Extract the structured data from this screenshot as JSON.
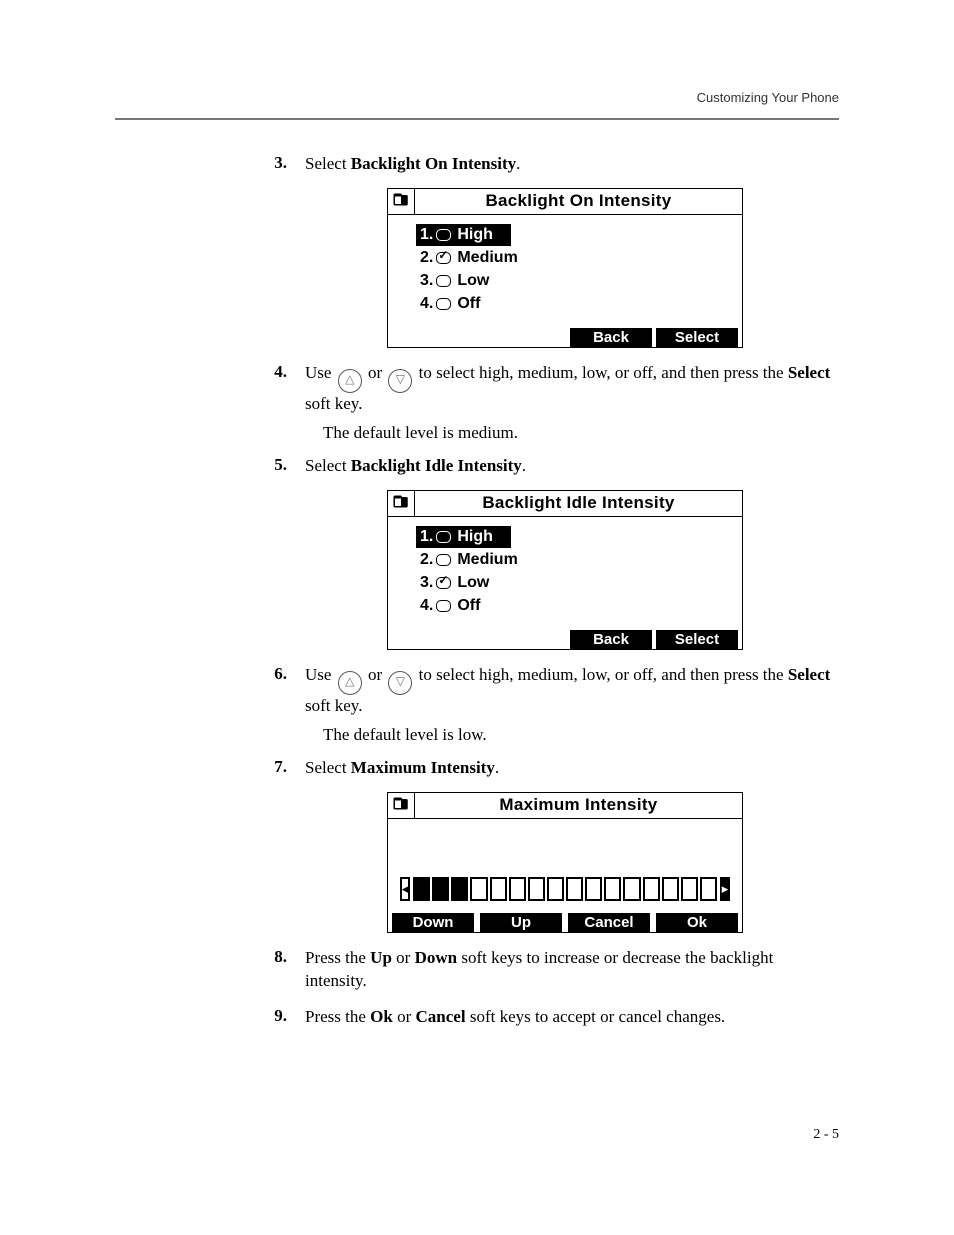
{
  "header": {
    "running_head": "Customizing Your Phone"
  },
  "steps": {
    "s3": {
      "num": "3.",
      "lead": "Select ",
      "bold": "Backlight On Intensity",
      "trail": "."
    },
    "s4": {
      "num": "4.",
      "lead": "Use ",
      "mid": " or ",
      "rest": " to select high, medium, low, or off, and then press the ",
      "bold": "Select",
      "trail": " soft key.",
      "note": "The default level is medium."
    },
    "s5": {
      "num": "5.",
      "lead": "Select ",
      "bold": "Backlight Idle Intensity",
      "trail": "."
    },
    "s6": {
      "num": "6.",
      "lead": "Use ",
      "mid": " or ",
      "rest": " to select high, medium, low, or off, and then press the ",
      "bold": "Select",
      "trail": " soft key.",
      "note": "The default level is low."
    },
    "s7": {
      "num": "7.",
      "lead": "Select ",
      "bold": "Maximum Intensity",
      "trail": "."
    },
    "s8": {
      "num": "8.",
      "t1": "Press the ",
      "b1": "Up",
      "t2": " or ",
      "b2": "Down",
      "t3": " soft keys to increase or decrease the backlight intensity."
    },
    "s9": {
      "num": "9.",
      "t1": "Press the ",
      "b1": "Ok",
      "t2": " or ",
      "b2": "Cancel",
      "t3": " soft keys to accept or cancel changes."
    }
  },
  "screen_on": {
    "title": "Backlight On Intensity",
    "items": {
      "i1": {
        "n": "1.",
        "label": "High"
      },
      "i2": {
        "n": "2.",
        "label": "Medium"
      },
      "i3": {
        "n": "3.",
        "label": "Low"
      },
      "i4": {
        "n": "4.",
        "label": "Off"
      }
    },
    "softkeys": {
      "back": "Back",
      "select": "Select"
    }
  },
  "screen_idle": {
    "title": "Backlight Idle Intensity",
    "items": {
      "i1": {
        "n": "1.",
        "label": "High"
      },
      "i2": {
        "n": "2.",
        "label": "Medium"
      },
      "i3": {
        "n": "3.",
        "label": "Low"
      },
      "i4": {
        "n": "4.",
        "label": "Off"
      }
    },
    "softkeys": {
      "back": "Back",
      "select": "Select"
    }
  },
  "screen_max": {
    "title": "Maximum Intensity",
    "level_filled": 3,
    "level_total": 16,
    "softkeys": {
      "down": "Down",
      "up": "Up",
      "cancel": "Cancel",
      "ok": "Ok"
    }
  },
  "icons": {
    "up": "△",
    "down": "▽",
    "decr": "◂",
    "incr": "▸"
  },
  "footer": {
    "page": "2 - 5"
  }
}
